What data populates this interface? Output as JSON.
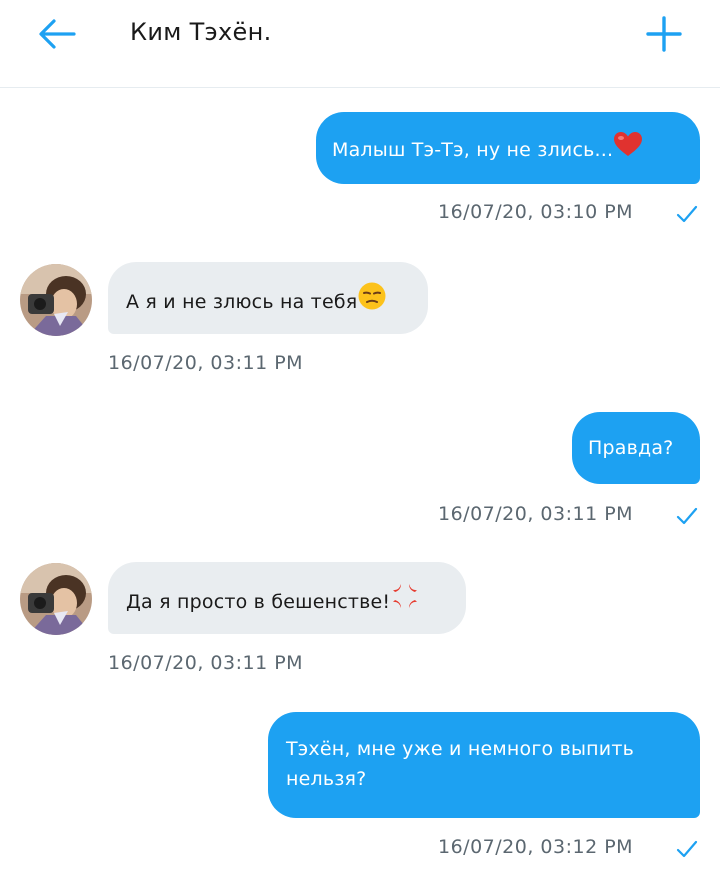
{
  "header": {
    "title": "Ким Тэхён.",
    "back_icon": "arrow-left-icon",
    "new_icon": "plus-icon",
    "accent": "#1da1f2"
  },
  "messages": [
    {
      "direction": "outgoing",
      "text": "Малыш Тэ-Тэ, ну не злись...",
      "emoji": "heart",
      "time": "16/07/20, 03:10 PM",
      "read": true
    },
    {
      "direction": "incoming",
      "text": "А я и не злюсь на тебя",
      "emoji": "unamused-face",
      "time": "16/07/20, 03:11 PM"
    },
    {
      "direction": "outgoing",
      "text": "Правда?",
      "time": "16/07/20, 03:11 PM",
      "read": true
    },
    {
      "direction": "incoming",
      "text": "Да я просто в бешенстве!",
      "emoji": "anger-symbol",
      "time": "16/07/20, 03:11 PM"
    },
    {
      "direction": "outgoing",
      "text": "Тэхён, мне уже и немного выпить нельзя?",
      "time": "16/07/20, 03:12 PM",
      "read": true
    }
  ],
  "colors": {
    "outgoing_bubble": "#1da1f2",
    "incoming_bubble": "#e9edf0",
    "timestamp": "#5b6770"
  }
}
